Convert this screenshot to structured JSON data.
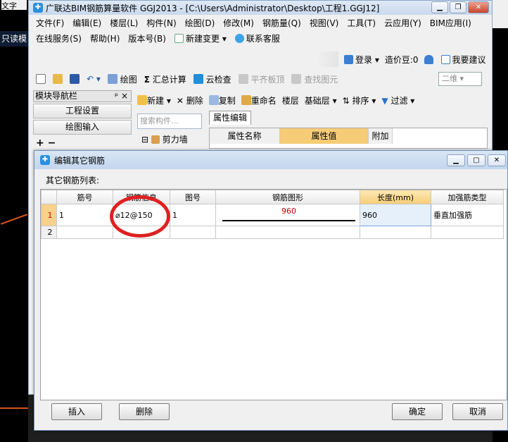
{
  "background": {
    "top_left_text": "文字",
    "readonly_label": "只读模"
  },
  "app": {
    "title": "广联达BIM钢筋算量软件 GGJ2013 - [C:\\Users\\Administrator\\Desktop\\工程1.GGJ12]",
    "menu_row1": [
      "文件(F)",
      "编辑(E)",
      "楼层(L)",
      "构件(N)",
      "绘图(D)",
      "修改(M)",
      "钢筋量(Q)",
      "视图(V)",
      "工具(T)",
      "云应用(Y)",
      "BIM应用(I)"
    ],
    "menu_row2": {
      "online": "在线服务(S)",
      "help": "帮助(H)",
      "version": "版本号(B)",
      "new_change": "新建变更",
      "support": "联系客服"
    },
    "login": {
      "login": "登录",
      "beans": "造价豆:0",
      "suggest": "我要建议"
    },
    "toolbar1": {
      "draw": "绘图",
      "calc": "汇总计算",
      "cloud_check": "云检查",
      "flatten": "平齐板顶",
      "find": "查找图元",
      "view_2d": "二维"
    },
    "nav": {
      "header": "模块导航栏",
      "pin": "ᵖ",
      "close": "×",
      "settings": "工程设置",
      "draw_input": "绘图输入",
      "plus": "+",
      "minus": "−"
    },
    "toolbar2": {
      "new": "新建",
      "delete": "删除",
      "copy": "复制",
      "rename": "重命名",
      "floor": "楼层",
      "base_floor": "基础层",
      "sort": "排序",
      "filter": "过滤"
    },
    "search_placeholder": "搜索构件...",
    "tree_item": "剪力墙",
    "property": {
      "tab": "属性编辑",
      "col_name": "属性名称",
      "col_value": "属性值",
      "col_extra": "附加"
    }
  },
  "dialog": {
    "title": "编辑其它钢筋",
    "list_label": "其它钢筋列表:",
    "columns": [
      "筋号",
      "钢筋信息",
      "图号",
      "钢筋图形",
      "长度(mm)",
      "加强筋类型"
    ],
    "rows": [
      {
        "row": "1",
        "bar_no": "1",
        "info": "⌀12@150",
        "fig_no": "1",
        "shape_value": "960",
        "length": "960",
        "type": "垂直加强筋"
      },
      {
        "row": "2",
        "bar_no": "",
        "info": "",
        "fig_no": "",
        "shape_value": "",
        "length": "",
        "type": ""
      }
    ],
    "buttons": {
      "insert": "插入",
      "delete": "删除",
      "ok": "确定",
      "cancel": "取消"
    }
  }
}
